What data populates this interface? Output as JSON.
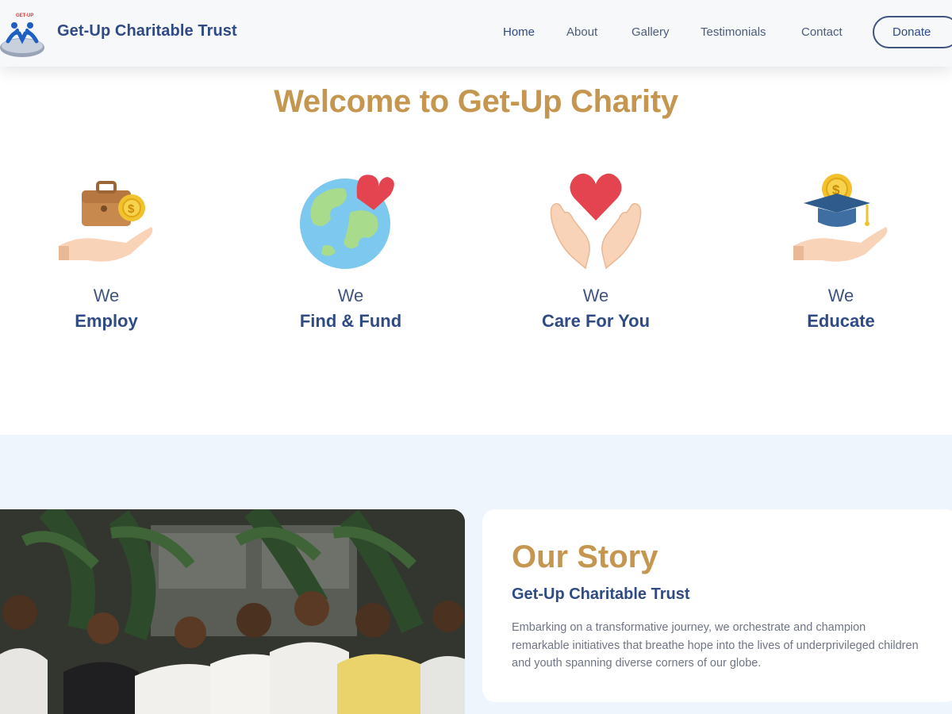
{
  "header": {
    "logo_icon": "get-up-logo",
    "logo_text": "GET-UP",
    "brand": "Get-Up Charitable Trust",
    "nav": [
      {
        "label": "Home",
        "active": true
      },
      {
        "label": "About"
      },
      {
        "label": "Gallery"
      },
      {
        "label": "Testimonials"
      },
      {
        "label": "Contact"
      }
    ],
    "donate_label": "Donate"
  },
  "welcome": {
    "title": "Welcome to Get-Up Charity",
    "features": [
      {
        "we": "We",
        "label": "Employ",
        "icon": "briefcase-hand-icon"
      },
      {
        "we": "We",
        "label": "Find & Fund",
        "icon": "globe-heart-icon"
      },
      {
        "we": "We",
        "label": "Care For You",
        "icon": "heart-hands-icon"
      },
      {
        "we": "We",
        "label": "Educate",
        "icon": "graduation-hand-icon"
      }
    ]
  },
  "story": {
    "title": "Our Story",
    "subtitle": "Get-Up Charitable Trust",
    "text": "Embarking on a transformative journey, we orchestrate and champion remarkable initiatives that breathe hope into the lives of underprivileged children and youth spanning diverse corners of our globe."
  },
  "colors": {
    "gold": "#c4964f",
    "navy": "#2f4a84",
    "section_bg": "#eef5fd"
  }
}
